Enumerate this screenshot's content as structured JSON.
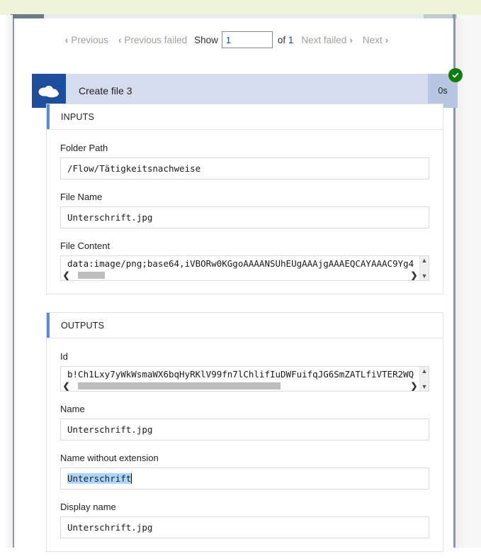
{
  "pager": {
    "previous_label": "Previous",
    "previous_failed_label": "Previous failed",
    "show_label": "Show",
    "page_value": "1",
    "of_label": "of",
    "total_pages": "1",
    "next_failed_label": "Next failed",
    "next_label": "Next",
    "chevron_left": "‹",
    "chevron_right": "›"
  },
  "action": {
    "title": "Create file 3",
    "duration": "0s",
    "icon": "onedrive-cloud-icon",
    "status": "succeeded",
    "status_icon": "checkmark-icon",
    "header_background": "#d4dcee",
    "icon_background": "#1e4d9b",
    "duration_background": "#b8c6e2",
    "status_color": "#107c10"
  },
  "inputs": {
    "section_title": "INPUTS",
    "fields": [
      {
        "label": "Folder Path",
        "value": "/Flow/Tätigkeitsnachweise",
        "scrollable": false
      },
      {
        "label": "File Name",
        "value": "Unterschrift.jpg",
        "scrollable": false
      },
      {
        "label": "File Content",
        "value": "data:image/png;base64,iVBORw0KGgoAAAANSUhEUgAAAjgAAAEQCAYAAAC9Yg4",
        "scrollable": true,
        "scroll_thumb_left_pct": 2,
        "scroll_thumb_width_pct": 8
      }
    ]
  },
  "outputs": {
    "section_title": "OUTPUTS",
    "fields": [
      {
        "label": "Id",
        "value": "b!Ch1Lxy7yWkWsmaWX6bqHyRKlV99fn7lChlifIuDWFuifqJG6SmZATLfiVTER2WQ",
        "scrollable": true,
        "scroll_thumb_left_pct": 2,
        "scroll_thumb_width_pct": 60
      },
      {
        "label": "Name",
        "value": "Unterschrift.jpg",
        "scrollable": false
      },
      {
        "label": "Name without extension",
        "value": "Unterschrift",
        "scrollable": false,
        "selected": true,
        "has_caret": true
      },
      {
        "label": "Display name",
        "value": "Unterschrift.jpg",
        "scrollable": false
      }
    ]
  }
}
